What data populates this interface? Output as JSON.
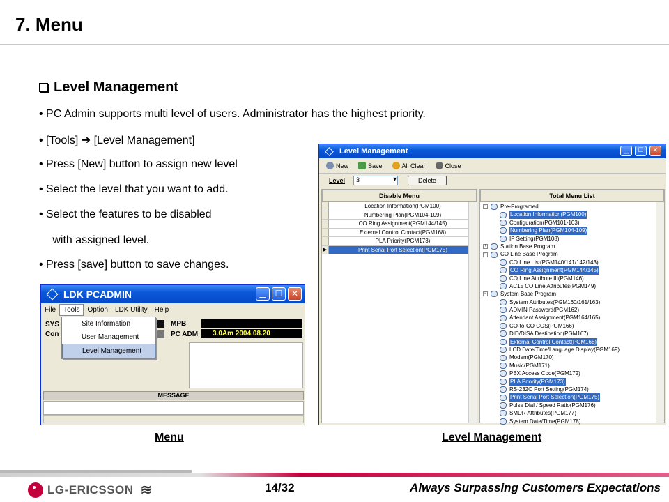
{
  "slide": {
    "title": "7. Menu",
    "section_heading": "Level Management",
    "bullets": [
      "• PC Admin supports multi level of users.  Administrator has the highest priority.",
      "• [Tools] ➔ [Level Management]",
      "• Press [New] button to assign new level",
      "• Select the level that you want to add.",
      "• Select the features to be disabled",
      "   with assigned level.",
      "• Press [save] button to save changes."
    ],
    "caption_left": "Menu",
    "caption_right": "Level Management"
  },
  "pcadmin": {
    "title": "LDK PCADMIN",
    "menu": [
      "File",
      "Tools",
      "Option",
      "LDK Utility",
      "Help"
    ],
    "dropdown": [
      "Site Information",
      "User Management",
      "Level Management"
    ],
    "left_labels": [
      "SYS",
      "Con"
    ],
    "mpb_label": "MPB",
    "pcadm_label": "PC ADM",
    "pcadm_value": "3.0Am 2004.08.20",
    "message_label": "MESSAGE"
  },
  "levelmgmt": {
    "title": "Level Management",
    "toolbar": [
      "New",
      "Save",
      "All Clear",
      "Close"
    ],
    "level_label": "Level",
    "level_value": "3",
    "delete_label": "Delete",
    "disable_header": "Disable Menu",
    "total_header": "Total Menu List",
    "disable_items": [
      "Location Information(PGM100)",
      "Numbering Plan(PGM104-109)",
      "CO Ring Assignment(PGM144/145)",
      "External Control Contact(PGM168)",
      "PLA Priority(PGM173)",
      "Print Serial Port Selection(PGM175)"
    ],
    "tree": [
      {
        "text": "Pre-Programed",
        "lvl": 0,
        "exp": "−"
      },
      {
        "text": "Location Information(PGM100)",
        "lvl": 1,
        "hl": true
      },
      {
        "text": "Configuration(PGM101-103)",
        "lvl": 1
      },
      {
        "text": "Numbering Plan(PGM104-109)",
        "lvl": 1,
        "hl": true
      },
      {
        "text": "IP Setting(PGM108)",
        "lvl": 1
      },
      {
        "text": "Station Base Program",
        "lvl": 0,
        "exp": "+"
      },
      {
        "text": "CO Line Base Program",
        "lvl": 0,
        "exp": "−"
      },
      {
        "text": "CO Line List(PGM140/141/142/143)",
        "lvl": 1
      },
      {
        "text": "CO Ring Assignment(PGM144/145)",
        "lvl": 1,
        "hl": true
      },
      {
        "text": "CO Line Attribute III(PGM146)",
        "lvl": 1
      },
      {
        "text": "AC15 CO Line Attributes(PGM149)",
        "lvl": 1
      },
      {
        "text": "System Base Program",
        "lvl": 0,
        "exp": "−"
      },
      {
        "text": "System Attributes(PGM160/161/163)",
        "lvl": 1
      },
      {
        "text": "ADMIN Password(PGM162)",
        "lvl": 1
      },
      {
        "text": "Attendant Assignment(PGM164/165)",
        "lvl": 1
      },
      {
        "text": "CO-to-CO COS(PGM166)",
        "lvl": 1
      },
      {
        "text": "DID/DISA Destination(PGM167)",
        "lvl": 1
      },
      {
        "text": "External Control Contact(PGM168)",
        "lvl": 1,
        "hl": true
      },
      {
        "text": "LCD Date/Time/Language Display(PGM169)",
        "lvl": 1
      },
      {
        "text": "Modem(PGM170)",
        "lvl": 1
      },
      {
        "text": "Music(PGM171)",
        "lvl": 1
      },
      {
        "text": "PBX Access Code(PGM172)",
        "lvl": 1
      },
      {
        "text": "PLA Priority(PGM173)",
        "lvl": 1,
        "hl": true
      },
      {
        "text": "RS-232C Port Setting(PGM174)",
        "lvl": 1
      },
      {
        "text": "Print Serial Port Selection(PGM175)",
        "lvl": 1,
        "hl": true
      },
      {
        "text": "Pulse Dial / Speed Ratio(PGM176)",
        "lvl": 1
      },
      {
        "text": "SMDR Attributes(PGM177)",
        "lvl": 1
      },
      {
        "text": "System Date/Time(PGM178)",
        "lvl": 1
      }
    ]
  },
  "footer": {
    "logo": "LG-ERICSSON",
    "page": "14/32",
    "tagline": "Always Surpassing Customers Expectations"
  },
  "colors": {
    "titlebar": "#0a58d8",
    "selection": "#316ac5",
    "brand": "#c2003c"
  }
}
